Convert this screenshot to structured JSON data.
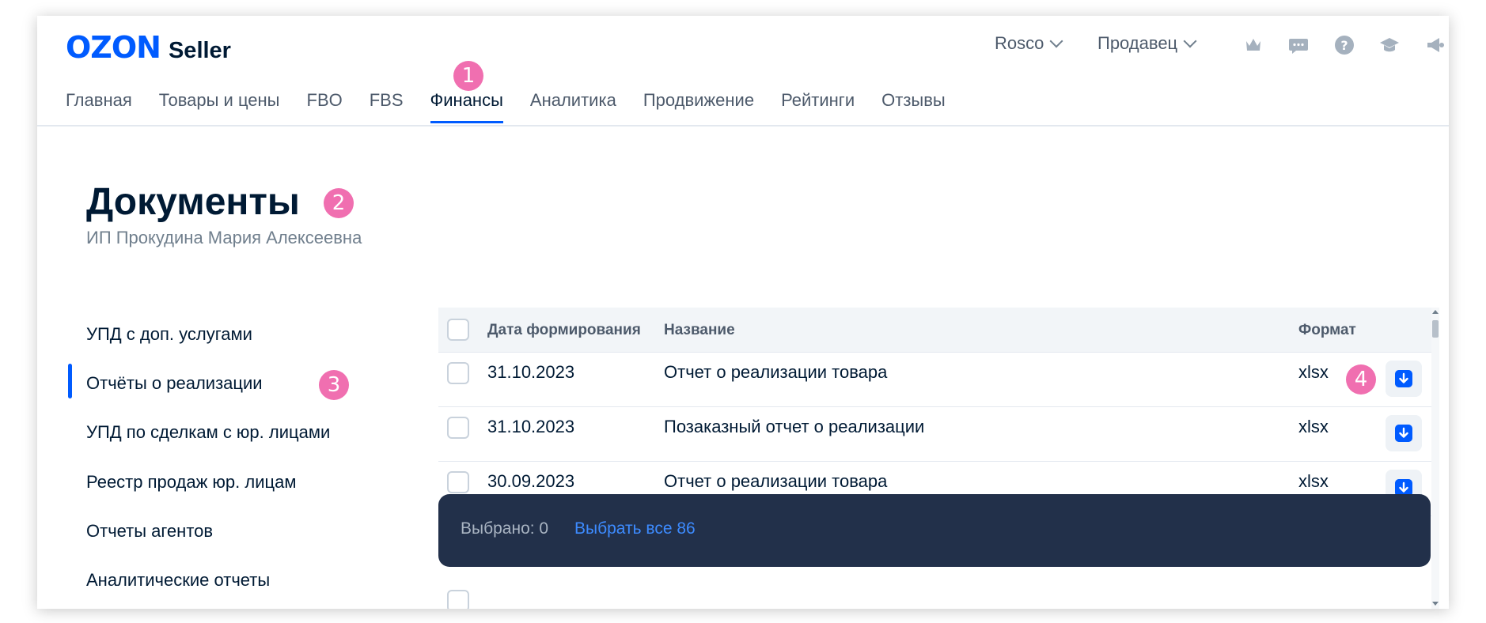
{
  "header": {
    "logo_brand": "OZON",
    "logo_product": "Seller",
    "company_dropdown": "Rosco",
    "role_dropdown": "Продавец",
    "icons": [
      "crown-icon",
      "chat-icon",
      "help-icon",
      "education-icon",
      "megaphone-icon"
    ]
  },
  "nav": {
    "tabs": [
      {
        "label": "Главная"
      },
      {
        "label": "Товары и цены"
      },
      {
        "label": "FBO"
      },
      {
        "label": "FBS"
      },
      {
        "label": "Финансы",
        "active": true
      },
      {
        "label": "Аналитика"
      },
      {
        "label": "Продвижение"
      },
      {
        "label": "Рейтинги"
      },
      {
        "label": "Отзывы"
      }
    ]
  },
  "page": {
    "title": "Документы",
    "subtitle": "ИП Прокудина Мария Алексеевна"
  },
  "sidebar": {
    "items": [
      {
        "label": "УПД с доп. услугами"
      },
      {
        "label": "Отчёты о реализации",
        "active": true
      },
      {
        "label": "УПД по сделкам с юр. лицами"
      },
      {
        "label": "Реестр продаж юр. лицам"
      },
      {
        "label": "Отчеты агентов"
      },
      {
        "label": "Аналитические отчеты"
      }
    ]
  },
  "table": {
    "columns": {
      "date": "Дата формирования",
      "name": "Название",
      "format": "Формат"
    },
    "rows": [
      {
        "date": "31.10.2023",
        "name": "Отчет о реализации товара",
        "format": "xlsx"
      },
      {
        "date": "31.10.2023",
        "name": "Позаказный отчет о реализации",
        "format": "xlsx"
      },
      {
        "date": "30.09.2023",
        "name": "Отчет о реализации товара",
        "format": "xlsx"
      }
    ]
  },
  "selection": {
    "count_text": "Выбрано: 0",
    "select_all_text": "Выбрать все 86"
  },
  "annotations": [
    "1",
    "2",
    "3",
    "4"
  ],
  "colors": {
    "accent": "#005bff",
    "badge": "#f06fb0",
    "selection_bar": "#22304a",
    "link": "#3d8bff"
  }
}
